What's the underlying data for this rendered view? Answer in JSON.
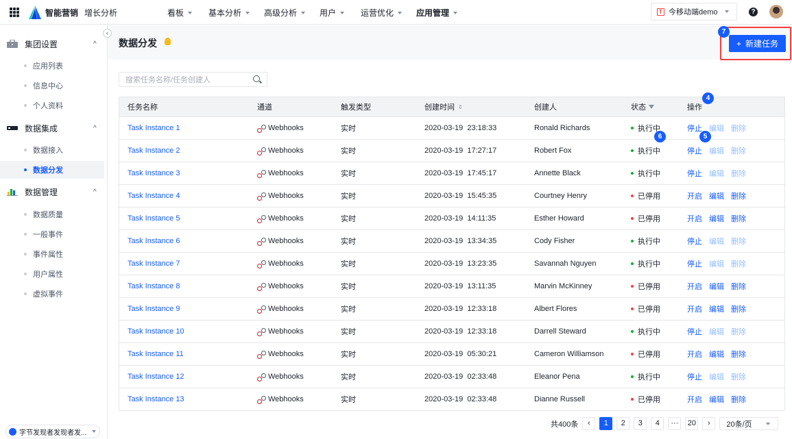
{
  "topbar": {
    "brand": "智能营销",
    "brand_sub": "增长分析",
    "nav": [
      {
        "label": "看板",
        "has_caret": true
      },
      {
        "label": "基本分析",
        "has_caret": true
      },
      {
        "label": "高级分析",
        "has_caret": true
      },
      {
        "label": "用户",
        "has_caret": true
      },
      {
        "label": "运营优化",
        "has_caret": true
      },
      {
        "label": "应用管理",
        "has_caret": true,
        "active": true
      }
    ],
    "app_badge": "T",
    "app_name": "今移动端demo",
    "help_icon": "?"
  },
  "sidebar": {
    "groups": [
      {
        "label": "集团设置",
        "icon": "briefcase-icon",
        "items": [
          "应用列表",
          "信息中心",
          "个人资料"
        ]
      },
      {
        "label": "数据集成",
        "icon": "server-icon",
        "items": [
          "数据接入",
          "数据分发"
        ]
      },
      {
        "label": "数据管理",
        "icon": "bar-chart-icon",
        "items": [
          "数据质量",
          "一般事件",
          "事件属性",
          "用户属性",
          "虚拟事件"
        ]
      }
    ],
    "active_item": "数据分发",
    "chevron": "^",
    "collapse": "‹",
    "footer": "字节发现者发现者发..."
  },
  "page": {
    "title": "数据分发",
    "new_button": "新建任务",
    "new_button_plus": "+",
    "search_placeholder": "搜索任务名称/任务创建人"
  },
  "markers": {
    "m4": "4",
    "m5": "5",
    "m6": "6",
    "m7": "7"
  },
  "table": {
    "headers": [
      "任务名称",
      "通道",
      "触发类型",
      "创建时间",
      "创建人",
      "状态",
      "操作"
    ],
    "rows": [
      {
        "name": "Task Instance 1",
        "channel": "Webhooks",
        "trigger": "实时",
        "time": "2020-03-19  23:18:33",
        "creator": "Ronald Richards",
        "status": "执行中",
        "on": true
      },
      {
        "name": "Task Instance 2",
        "channel": "Webhooks",
        "trigger": "实时",
        "time": "2020-03-19  17:27:17",
        "creator": "Robert Fox",
        "status": "执行中",
        "on": true
      },
      {
        "name": "Task Instance 3",
        "channel": "Webhooks",
        "trigger": "实时",
        "time": "2020-03-19  17:45:17",
        "creator": "Annette Black",
        "status": "执行中",
        "on": true
      },
      {
        "name": "Task Instance 4",
        "channel": "Webhooks",
        "trigger": "实时",
        "time": "2020-03-19  15:45:35",
        "creator": "Courtney Henry",
        "status": "已停用",
        "on": false
      },
      {
        "name": "Task Instance 5",
        "channel": "Webhooks",
        "trigger": "实时",
        "time": "2020-03-19  14:11:35",
        "creator": "Esther Howard",
        "status": "已停用",
        "on": false
      },
      {
        "name": "Task Instance 6",
        "channel": "Webhooks",
        "trigger": "实时",
        "time": "2020-03-19  13:34:35",
        "creator": "Cody Fisher",
        "status": "执行中",
        "on": true
      },
      {
        "name": "Task Instance 7",
        "channel": "Webhooks",
        "trigger": "实时",
        "time": "2020-03-19  13:23:35",
        "creator": "Savannah Nguyen",
        "status": "执行中",
        "on": true
      },
      {
        "name": "Task Instance 8",
        "channel": "Webhooks",
        "trigger": "实时",
        "time": "2020-03-19  13:11:35",
        "creator": "Marvin McKinney",
        "status": "已停用",
        "on": false
      },
      {
        "name": "Task Instance 9",
        "channel": "Webhooks",
        "trigger": "实时",
        "time": "2020-03-19  12:33:18",
        "creator": "Albert Flores",
        "status": "已停用",
        "on": false
      },
      {
        "name": "Task Instance 10",
        "channel": "Webhooks",
        "trigger": "实时",
        "time": "2020-03-19  12:33:18",
        "creator": "Darrell Steward",
        "status": "执行中",
        "on": true
      },
      {
        "name": "Task Instance 11",
        "channel": "Webhooks",
        "trigger": "实时",
        "time": "2020-03-19  05:30:21",
        "creator": "Cameron Williamson",
        "status": "已停用",
        "on": false
      },
      {
        "name": "Task Instance 12",
        "channel": "Webhooks",
        "trigger": "实时",
        "time": "2020-03-19  02:33:48",
        "creator": "Eleanor Pena",
        "status": "执行中",
        "on": true
      },
      {
        "name": "Task Instance 13",
        "channel": "Webhooks",
        "trigger": "实时",
        "time": "2020-03-19  02:33:48",
        "creator": "Dianne Russell",
        "status": "已停用",
        "on": false
      }
    ],
    "actions_running": [
      "停止",
      "编辑",
      "删除"
    ],
    "actions_stopped": [
      "开启",
      "编辑",
      "删除"
    ]
  },
  "pagination": {
    "total": "共400条",
    "prev": "‹",
    "pages": [
      "1",
      "2",
      "3",
      "4",
      "···",
      "20"
    ],
    "current": "1",
    "next": "›",
    "size": "20条/页"
  },
  "colors": {
    "primary": "#165dff",
    "running": "#00b42a",
    "stopped": "#f53f3f",
    "highlight": "#f53f3f"
  }
}
